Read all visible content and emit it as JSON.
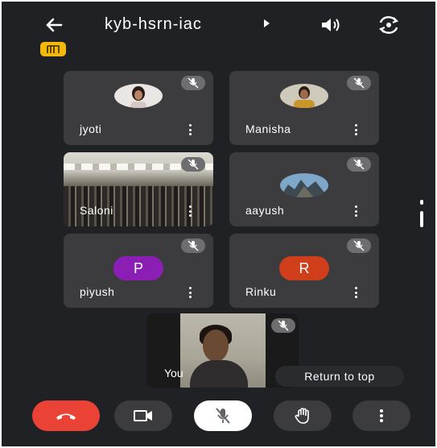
{
  "header": {
    "meeting_code": "kyb-hsrn-iac"
  },
  "participants": [
    {
      "name": "jyoti",
      "mic": "muted",
      "avatar": "photo"
    },
    {
      "name": "Manisha",
      "mic": "muted",
      "avatar": "photo"
    },
    {
      "name": "Saloni",
      "mic": "muted",
      "avatar": "video"
    },
    {
      "name": "aayush",
      "mic": "muted",
      "avatar": "photo"
    },
    {
      "name": "piyush",
      "mic": "muted",
      "avatar": "letter",
      "letter": "P",
      "color": "#8b1fb5"
    },
    {
      "name": "Rinku",
      "mic": "muted",
      "avatar": "letter",
      "letter": "R",
      "color": "#d13e1c"
    }
  ],
  "self": {
    "label": "You",
    "mic": "muted"
  },
  "return_to_top": "Return to top",
  "controls": {
    "end_call_color": "#ea4335",
    "icons": [
      "end-call-icon",
      "camera-icon",
      "mic-off-icon",
      "raise-hand-icon",
      "more-vert-icon"
    ]
  }
}
